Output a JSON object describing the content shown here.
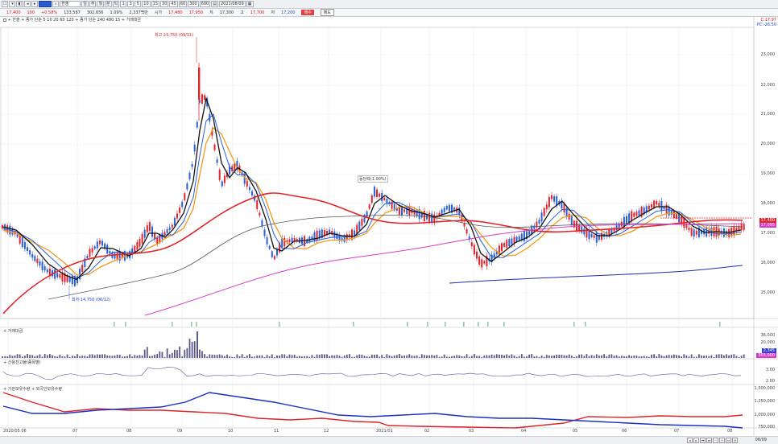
{
  "toolbar": {
    "stock_name": "한솔",
    "left_buttons": [
      "☐",
      "▾",
      "◧",
      "◂",
      "▸"
    ],
    "mid_buttons": [
      "일",
      "주",
      "월",
      "분",
      "틱",
      "1",
      "3",
      "5",
      "10",
      "15",
      "30",
      "45",
      "60"
    ],
    "count": "300",
    "view": "600",
    "date": "2021/08/09"
  },
  "quote": {
    "price": "17,400",
    "change": "100",
    "change_pct": "+0.58%",
    "volume": "133,587",
    "trade_amount": "302,656",
    "ratio": "1.09%",
    "shares": "2,337백만",
    "open_label": "시가",
    "open": "17,480",
    "high_label": "고",
    "high": "17,950",
    "low_label": "저",
    "low": "17,300",
    "prev_label": "고",
    "prev_high": "17,700",
    "prev_low_label": "저",
    "prev_low": "17,200",
    "buy_label": "매수",
    "sell_label": "매도"
  },
  "main_legend": "+ 한솔 + 종가 단순 5 10 20 60 120 + 종가 단순 240 480 15 + 거래대금",
  "annotations": {
    "high": "최고 23,750 (09/11)",
    "low": "최저 14,750 (06/12)",
    "mark": "동당락(1.00%)"
  },
  "panels": {
    "volume": "+ 거래대금",
    "credit": "+ 신용잔고율(종목별)",
    "foreign": "+ 기관보유수량 + 외국인보유수량"
  },
  "yaxis": {
    "price_labels": [
      "23,000",
      "22,000",
      "21,000",
      "20,000",
      "19,000",
      "18,000",
      "17,000",
      "16,000",
      "15,000"
    ],
    "top_red": "C:17.97",
    "top_blue": "PC:-26.50",
    "price_tag": "17,400",
    "ma_tag": "17,095",
    "volume_labels": [
      "38,000",
      "20,000"
    ],
    "volume_tag": "2,345",
    "volume_tag2": "303,000",
    "credit_labels": [
      "3.00",
      "2.00"
    ],
    "foreign_labels": [
      "1,500,000",
      "1,250,000",
      "1,000,000",
      "750,000"
    ]
  },
  "xaxis": [
    "2020/05 06",
    "07",
    "08",
    "09",
    "10",
    "11",
    "12",
    "2021/01",
    "02",
    "03",
    "04",
    "05",
    "06",
    "07",
    "08"
  ],
  "bottom_date": "08/09",
  "nav": [
    "◂",
    "▸",
    "⏮",
    "⏭",
    "－",
    "＋",
    "⇔",
    "◷"
  ],
  "colors": {
    "up": "#e0242c",
    "down": "#2a5fd6",
    "ma5": "#111111",
    "ma10": "#2a5fd6",
    "ma20": "#f29a1c",
    "ma60": "#e0242c",
    "ma120": "#555555",
    "ma240": "#d63ac7",
    "ma480": "#1f2fa8"
  }
}
